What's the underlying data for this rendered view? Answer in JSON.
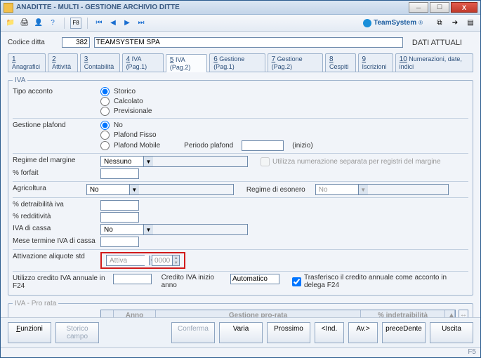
{
  "window": {
    "title": "ANADITTE  - MULTI -   GESTIONE ARCHIVIO DITTE"
  },
  "brand": {
    "name": "TeamSystem",
    "reg": "®"
  },
  "header": {
    "code_label": "Codice ditta",
    "code_value": "382",
    "company_name": "TEAMSYSTEM SPA",
    "status_right": "DATI ATTUALI"
  },
  "tabs": [
    {
      "n": "1",
      "label": "Anagrafici"
    },
    {
      "n": "2",
      "label": "Attività"
    },
    {
      "n": "3",
      "label": "Contabilità"
    },
    {
      "n": "4",
      "label": "IVA (Pag.1)"
    },
    {
      "n": "5",
      "label": "IVA (Pag.2)",
      "active": true
    },
    {
      "n": "6",
      "label": "Gestione (Pag.1)"
    },
    {
      "n": "7",
      "label": "Gestione (Pag.2)"
    },
    {
      "n": "8",
      "label": "Cespiti"
    },
    {
      "n": "9",
      "label": "Iscrizioni"
    },
    {
      "n": "10",
      "label": "Numerazioni, date, indici"
    }
  ],
  "groups": {
    "iva_legend": "IVA",
    "prorata_legend": "IVA - Pro rata"
  },
  "fields": {
    "tipo_acconto": {
      "label": "Tipo acconto",
      "options": [
        "Storico",
        "Calcolato",
        "Previsionale"
      ],
      "selected": 0
    },
    "gestione_plafond": {
      "label": "Gestione plafond",
      "options": [
        "No",
        "Plafond Fisso",
        "Plafond Mobile"
      ],
      "selected": 0,
      "periodo_label": "Periodo plafond",
      "periodo_value": "",
      "periodo_hint": "(inizio)"
    },
    "regime_margine": {
      "label": "Regime del margine",
      "value": "Nessuno",
      "chk_label": "Utilizza numerazione separata per registri del margine"
    },
    "forfait": {
      "label": "% forfait",
      "value": ""
    },
    "agricoltura": {
      "label": "Agricoltura",
      "value": "No",
      "regime_esonero_label": "Regime di esonero",
      "regime_esonero_value": "No"
    },
    "detr": {
      "label": "% detraibilità iva",
      "value": ""
    },
    "redd": {
      "label": "% redditività",
      "value": ""
    },
    "iva_cassa": {
      "label": "IVA di cassa",
      "value": "No"
    },
    "mese_termine": {
      "label": "Mese termine IVA di cassa",
      "value": ""
    },
    "aliquote_std": {
      "label": "Attivazione aliquote std",
      "combo": "Attiva",
      "year": "0000"
    },
    "utilizzo_credito": {
      "label": "Utilizzo credito IVA annuale in F24",
      "value": "",
      "credito_inizio_label": "Credito IVA inizio anno",
      "credito_inizio_value": "Automatico",
      "trasf_label": "Trasferisco il credito annuale come acconto in delega F24"
    }
  },
  "grid": {
    "cols": [
      "Anno",
      "Gestione pro-rata",
      "% indetraibilità"
    ]
  },
  "buttons": {
    "funzioni": "Funzioni",
    "storico": "Storico campo",
    "conferma": "Conferma",
    "varia": "Varia",
    "prossimo": "Prossimo",
    "ind": "<Ind.",
    "av": "Av.>",
    "precedente": "preceDente",
    "uscita": "Uscita"
  },
  "status_bar": "F5"
}
